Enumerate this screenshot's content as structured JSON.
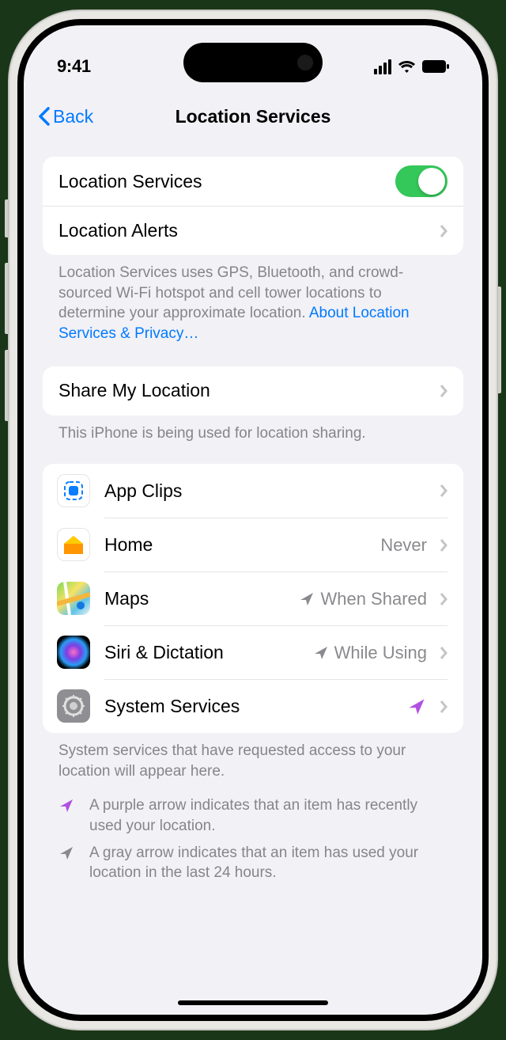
{
  "status": {
    "time": "9:41"
  },
  "nav": {
    "back_label": "Back",
    "title": "Location Services"
  },
  "main_toggle": {
    "label": "Location Services",
    "on": true
  },
  "alerts": {
    "label": "Location Alerts"
  },
  "privacy_text": "Location Services uses GPS, Bluetooth, and crowd-sourced Wi-Fi hotspot and cell tower locations to determine your approximate location. ",
  "privacy_link": "About Location Services & Privacy…",
  "share": {
    "label": "Share My Location"
  },
  "share_footer": "This iPhone is being used for location sharing.",
  "apps": [
    {
      "name": "App Clips",
      "status": "",
      "arrow": "none",
      "icon": "appclips"
    },
    {
      "name": "Home",
      "status": "Never",
      "arrow": "none",
      "icon": "home"
    },
    {
      "name": "Maps",
      "status": "When Shared",
      "arrow": "gray",
      "icon": "maps"
    },
    {
      "name": "Siri & Dictation",
      "status": "While Using",
      "arrow": "gray",
      "icon": "siri"
    },
    {
      "name": "System Services",
      "status": "",
      "arrow": "purple",
      "icon": "settings"
    }
  ],
  "system_footer": "System services that have requested access to your location will appear here.",
  "legend_purple": "A purple arrow indicates that an item has recently used your location.",
  "legend_gray": "A gray arrow indicates that an item has used your location in the last 24 hours.",
  "colors": {
    "link": "#007aff",
    "toggle_on": "#34c759",
    "arrow_purple": "#b150e2",
    "arrow_gray": "#8a8a8e"
  }
}
